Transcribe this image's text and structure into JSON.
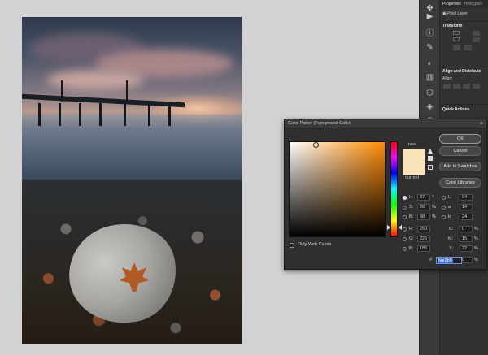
{
  "panel": {
    "tabs": [
      "Properties",
      "Histogram"
    ],
    "layer_type": "Pixel Layer",
    "section_transform": "Transform",
    "section_align": "Align and Distribute",
    "align_label": "Align:",
    "section_quick": "Quick Actions"
  },
  "dialog": {
    "title": "Color Picker (Foreground Color)",
    "close": "×",
    "new_label": "new",
    "current_label": "current",
    "only_web_colors": "Only Web Colors",
    "buttons": {
      "ok": "OK",
      "cancel": "Cancel",
      "add_to_swatches": "Add to Swatches",
      "color_libraries": "Color Libraries"
    },
    "hsb": {
      "h_label": "H:",
      "h_value": "37",
      "h_unit": "°",
      "s_label": "S:",
      "s_value": "26",
      "s_unit": "%",
      "b_label": "B:",
      "b_value": "98",
      "b_unit": "%"
    },
    "rgb": {
      "r_label": "R:",
      "r_value": "250",
      "g_label": "G:",
      "g_value": "226",
      "b_label": "B:",
      "b_value": "185"
    },
    "lab": {
      "l_label": "L:",
      "l_value": "94",
      "a_label": "a:",
      "a_value": "14",
      "b_label": "b:",
      "b_value": "24"
    },
    "cmyk": {
      "c_label": "C:",
      "c_value": "0",
      "c_unit": "%",
      "m_label": "M:",
      "m_value": "15",
      "m_unit": "%",
      "y_label": "Y:",
      "y_value": "22",
      "y_unit": "%",
      "k_label": "K:",
      "k_value": "0",
      "k_unit": "%"
    },
    "hex_label": "#",
    "hex_value": "fae2b9",
    "colors": {
      "selected": "#fae2b9",
      "hue": "#ff8a00"
    }
  },
  "toolbar": {
    "icons": [
      "move-icon",
      "play-icon",
      "info-icon",
      "brush-icon",
      "adjust-icon",
      "gradient-icon",
      "cube-icon",
      "layers-icon",
      "channels-icon",
      "paths-icon"
    ]
  }
}
